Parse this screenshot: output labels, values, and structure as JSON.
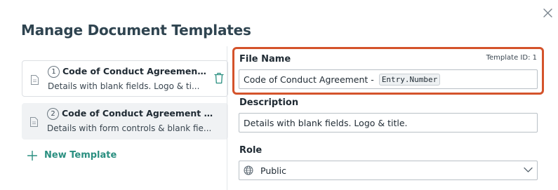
{
  "dialog": {
    "title": "Manage Document Templates"
  },
  "templates": [
    {
      "number": "1",
      "title": "Code of Conduct Agreement ...",
      "description": "Details with blank fields. Logo & ti...",
      "selected": false
    },
    {
      "number": "2",
      "title": "Code of Conduct Agreement - ...",
      "description": "Details with form controls & blank fie...",
      "selected": true
    }
  ],
  "new_template_label": "New Template",
  "form": {
    "file_name_label": "File Name",
    "template_id_text": "Template ID: 1",
    "file_name_value": "Code of Conduct Agreement -",
    "file_name_token": "Entry.Number",
    "description_label": "Description",
    "description_value": "Details with blank fields. Logo & title.",
    "role_label": "Role",
    "role_value": "Public"
  },
  "icons": {
    "close": "close-icon",
    "document": "document-icon",
    "trash": "trash-icon",
    "plus": "plus-icon",
    "globe": "globe-icon",
    "chevron": "chevron-down-icon"
  },
  "colors": {
    "accent": "#2a8f80",
    "highlight_border": "#d4532b",
    "title": "#2f4450",
    "selected_bg": "#f0f2f4"
  }
}
